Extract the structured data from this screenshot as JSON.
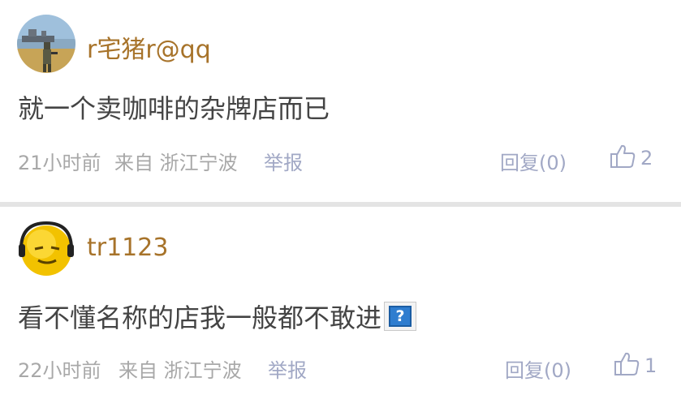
{
  "comments": [
    {
      "username": "r宅猪r@qq",
      "content": "就一个卖咖啡的杂牌店而已",
      "time": "21小时前",
      "source": "来自 浙江宁波",
      "report_label": "举报",
      "reply_label": "回复(0)",
      "likes": "2"
    },
    {
      "username": "tr1123",
      "content": "看不懂名称的店我一般都不敢进",
      "emoji_glyph": "?",
      "time": "22小时前",
      "source": "来自 浙江宁波",
      "report_label": "举报",
      "reply_label": "回复(0)",
      "likes": "1"
    }
  ],
  "colors": {
    "username": "#a7732a",
    "content": "#444444",
    "meta": "#a8a8a8",
    "action": "#a1a8c5",
    "divider": "#e4e4e4"
  },
  "icons": {
    "like": "thumbs-up-icon",
    "emoji": "question-emoji-icon"
  }
}
